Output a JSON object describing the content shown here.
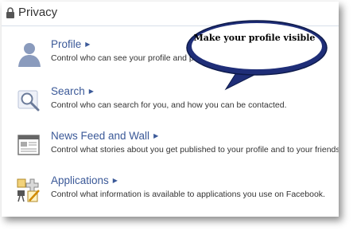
{
  "header": {
    "title": "Privacy",
    "icon": "lock-icon"
  },
  "items": [
    {
      "name": "Profile",
      "description": "Control who can see your profile and personal information.",
      "icon": "person-silhouette-icon"
    },
    {
      "name": "Search",
      "description": "Control who can search for you, and how you can be contacted.",
      "icon": "magnifier-icon"
    },
    {
      "name": "News Feed and Wall",
      "description": "Control what stories about you get published to your profile and to your friends' News Feeds.",
      "icon": "news-feed-icon"
    },
    {
      "name": "Applications",
      "description": "Control what information is available to applications you use on Facebook.",
      "icon": "applications-icon"
    }
  ],
  "callout": {
    "text": "Make your profile visible"
  },
  "colors": {
    "link": "#3b5998",
    "text": "#333333",
    "callout_fill": "#1f2e78",
    "callout_border": "#0d1a4a"
  }
}
